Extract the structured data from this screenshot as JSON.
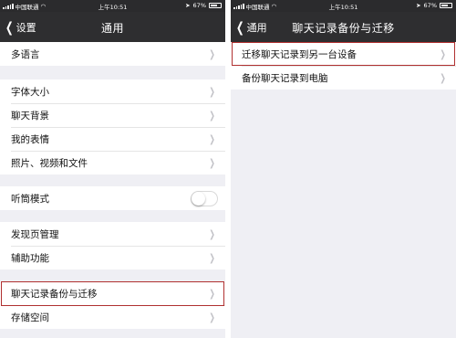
{
  "left": {
    "status": {
      "carrier": "中国联通",
      "time": "上午10:51",
      "battery": "67%"
    },
    "nav": {
      "back_label": "设置",
      "title": "通用"
    },
    "groups": [
      [
        "多语言"
      ],
      [
        "字体大小",
        "聊天背景",
        "我的表情",
        "照片、视频和文件"
      ],
      [
        "听筒模式"
      ],
      [
        "发现页管理",
        "辅助功能"
      ],
      [
        "聊天记录备份与迁移",
        "存储空间"
      ]
    ],
    "listen_toggle_on": false
  },
  "right": {
    "status": {
      "carrier": "中国联通",
      "time": "上午10:51",
      "battery": "67%"
    },
    "nav": {
      "back_label": "通用",
      "title": "聊天记录备份与迁移"
    },
    "items": [
      "迁移聊天记录到另一台设备",
      "备份聊天记录到电脑"
    ]
  },
  "colors": {
    "navbar": "#2e2e30",
    "highlight": "#b03030",
    "background": "#efeff4"
  },
  "icons": {
    "back": "chevron-left-icon",
    "disclosure": "chevron-right-icon"
  }
}
